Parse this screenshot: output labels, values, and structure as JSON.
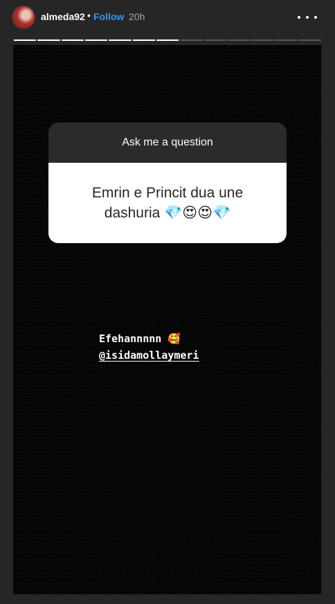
{
  "header": {
    "username": "almeda92",
    "separator": "•",
    "follow_label": "Follow",
    "time": "20h",
    "more_icon": "more-horizontal-icon"
  },
  "progress": {
    "total": 13,
    "current": 7
  },
  "question_box": {
    "prompt": "Ask me a question",
    "answer": "Emrin e Princit dua une dashuria 💎😍😍💎"
  },
  "caption": {
    "line1": "Efehannnnn 🥰",
    "mention": "@isidamollaymeri"
  },
  "colors": {
    "background": "#262626",
    "follow": "#3897f0",
    "story_bg": "#050505"
  }
}
